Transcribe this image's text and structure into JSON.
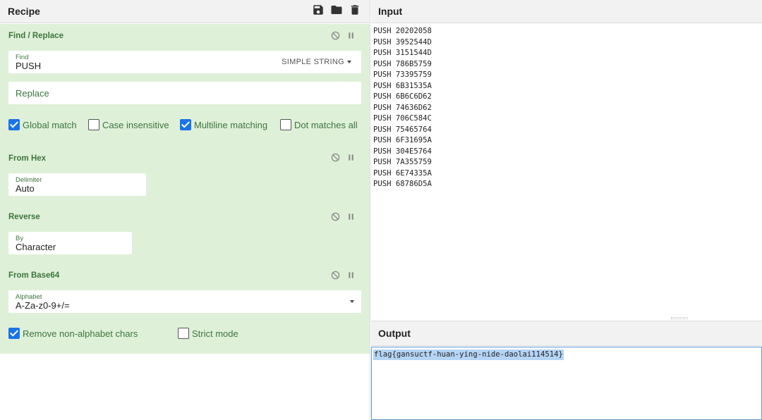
{
  "recipe": {
    "title": "Recipe",
    "icons": [
      "save-icon",
      "folder-icon",
      "trash-icon"
    ],
    "operations": [
      {
        "title": "Find / Replace",
        "find_label": "Find",
        "find_value": "PUSH",
        "find_mode": "SIMPLE STRING",
        "replace_placeholder": "Replace",
        "checkboxes": [
          {
            "label": "Global match",
            "checked": true
          },
          {
            "label": "Case insensitive",
            "checked": false
          },
          {
            "label": "Multiline matching",
            "checked": true
          },
          {
            "label": "Dot matches all",
            "checked": false
          }
        ]
      },
      {
        "title": "From Hex",
        "delimiter_label": "Delimiter",
        "delimiter_value": "Auto"
      },
      {
        "title": "Reverse",
        "by_label": "By",
        "by_value": "Character"
      },
      {
        "title": "From Base64",
        "alphabet_label": "Alphabet",
        "alphabet_value": "A-Za-z0-9+/=",
        "checkboxes": [
          {
            "label": "Remove non-alphabet chars",
            "checked": true
          },
          {
            "label": "Strict mode",
            "checked": false
          }
        ]
      }
    ]
  },
  "input": {
    "title": "Input",
    "lines": [
      "PUSH 20202058",
      "PUSH 3952544D",
      "PUSH 3151544D",
      "PUSH 786B5759",
      "PUSH 73395759",
      "PUSH 6B31535A",
      "PUSH 6B6C6D62",
      "PUSH 74636D62",
      "PUSH 706C584C",
      "PUSH 75465764",
      "PUSH 6F31695A",
      "PUSH 304E5764",
      "PUSH 7A355759",
      "PUSH 6E74335A",
      "PUSH 68786D5A"
    ]
  },
  "output": {
    "title": "Output",
    "text": "flag{gansuctf-huan-ying-nide-daolai114514}"
  },
  "colors": {
    "op_background": "#dff0d8",
    "op_text": "#3c763d",
    "checkbox_checked": "#1a73e8",
    "selection": "#b5d4f5"
  }
}
